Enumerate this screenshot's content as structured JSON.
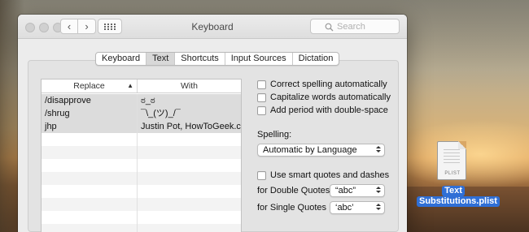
{
  "window": {
    "title": "Keyboard",
    "search_placeholder": "Search"
  },
  "tabs": [
    {
      "label": "Keyboard",
      "active": false
    },
    {
      "label": "Text",
      "active": true
    },
    {
      "label": "Shortcuts",
      "active": false
    },
    {
      "label": "Input Sources",
      "active": false
    },
    {
      "label": "Dictation",
      "active": false
    }
  ],
  "table": {
    "col_replace": "Replace",
    "col_with": "With",
    "rows": [
      {
        "replace": "/disapprove",
        "with": "ಠ_ಠ"
      },
      {
        "replace": "/shrug",
        "with": "¯\\_(ツ)_/¯"
      },
      {
        "replace": "jhp",
        "with": "Justin Pot, HowToGeek.com"
      }
    ]
  },
  "options": {
    "correct_spelling": "Correct spelling automatically",
    "capitalize_words": "Capitalize words automatically",
    "add_period": "Add period with double-space",
    "spelling_label": "Spelling:",
    "spelling_value": "Automatic by Language",
    "smart_quotes": "Use smart quotes and dashes",
    "double_quotes_label": "for Double Quotes",
    "double_quotes_value": "“abc”",
    "single_quotes_label": "for Single Quotes",
    "single_quotes_value": "‘abc’"
  },
  "desktop_file": {
    "type": "PLIST",
    "name_line1": "Text",
    "name_line2": "Substitutions.plist"
  }
}
